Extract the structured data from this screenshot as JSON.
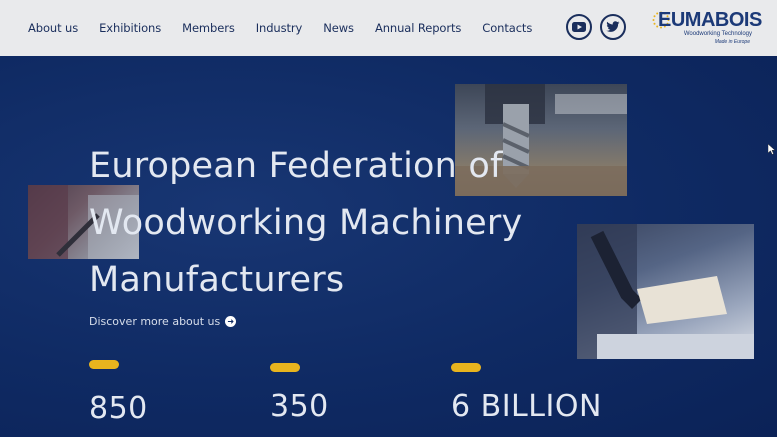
{
  "nav": {
    "items": [
      "About us",
      "Exhibitions",
      "Members",
      "Industry",
      "News",
      "Annual Reports",
      "Contacts"
    ]
  },
  "social": {
    "youtube_icon": "youtube-icon",
    "twitter_icon": "twitter-icon"
  },
  "logo": {
    "word": "EUMABOIS",
    "line1": "Woodworking Technology",
    "line2": "Made in Europe"
  },
  "hero": {
    "title_lines": [
      "European Federation of",
      "Woodworking Machinery",
      "Manufacturers"
    ],
    "discover_label": "Discover more about us"
  },
  "stats": [
    {
      "value": "850"
    },
    {
      "value": "350"
    },
    {
      "value": "6 BILLION"
    }
  ],
  "colors": {
    "navy": "#0f2a63",
    "accent": "#e8b41e",
    "header_bg": "#e9eaec"
  }
}
